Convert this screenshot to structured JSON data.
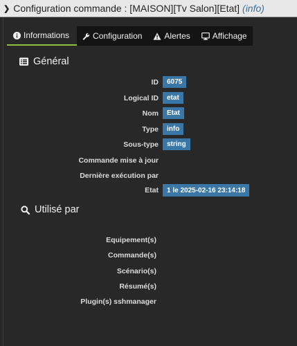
{
  "titlebar": {
    "title": "Configuration commande : [MAISON][Tv Salon][Etat]",
    "type_label": "(info)"
  },
  "tabs": [
    {
      "label": "Informations",
      "icon": "info-circle-icon"
    },
    {
      "label": "Configuration",
      "icon": "wrench-icon"
    },
    {
      "label": "Alertes",
      "icon": "warning-icon"
    },
    {
      "label": "Affichage",
      "icon": "monitor-icon"
    }
  ],
  "general": {
    "title": "Général",
    "icon": "list-icon",
    "rows": [
      {
        "label": "ID",
        "value": "6075"
      },
      {
        "label": "Logical ID",
        "value": "etat"
      },
      {
        "label": "Nom",
        "value": "Etat"
      },
      {
        "label": "Type",
        "value": "info"
      },
      {
        "label": "Sous-type",
        "value": "string"
      },
      {
        "label": "Commande mise à jour",
        "value": ""
      },
      {
        "label": "Dernière exécution par",
        "value": ""
      },
      {
        "label": "Etat",
        "value": "1 le 2025-02-16 23:14:18"
      }
    ]
  },
  "used_by": {
    "title": "Utilisé par",
    "icon": "search-icon",
    "rows": [
      {
        "label": "Equipement(s)"
      },
      {
        "label": "Commande(s)"
      },
      {
        "label": "Scénario(s)"
      },
      {
        "label": "Résumé(s)"
      },
      {
        "label": "Plugin(s) sshmanager"
      }
    ]
  },
  "colors": {
    "accent_tab": "#8cbf3f",
    "badge": "#3a76a6",
    "background": "#282828",
    "type_link": "#3e6f9e"
  }
}
